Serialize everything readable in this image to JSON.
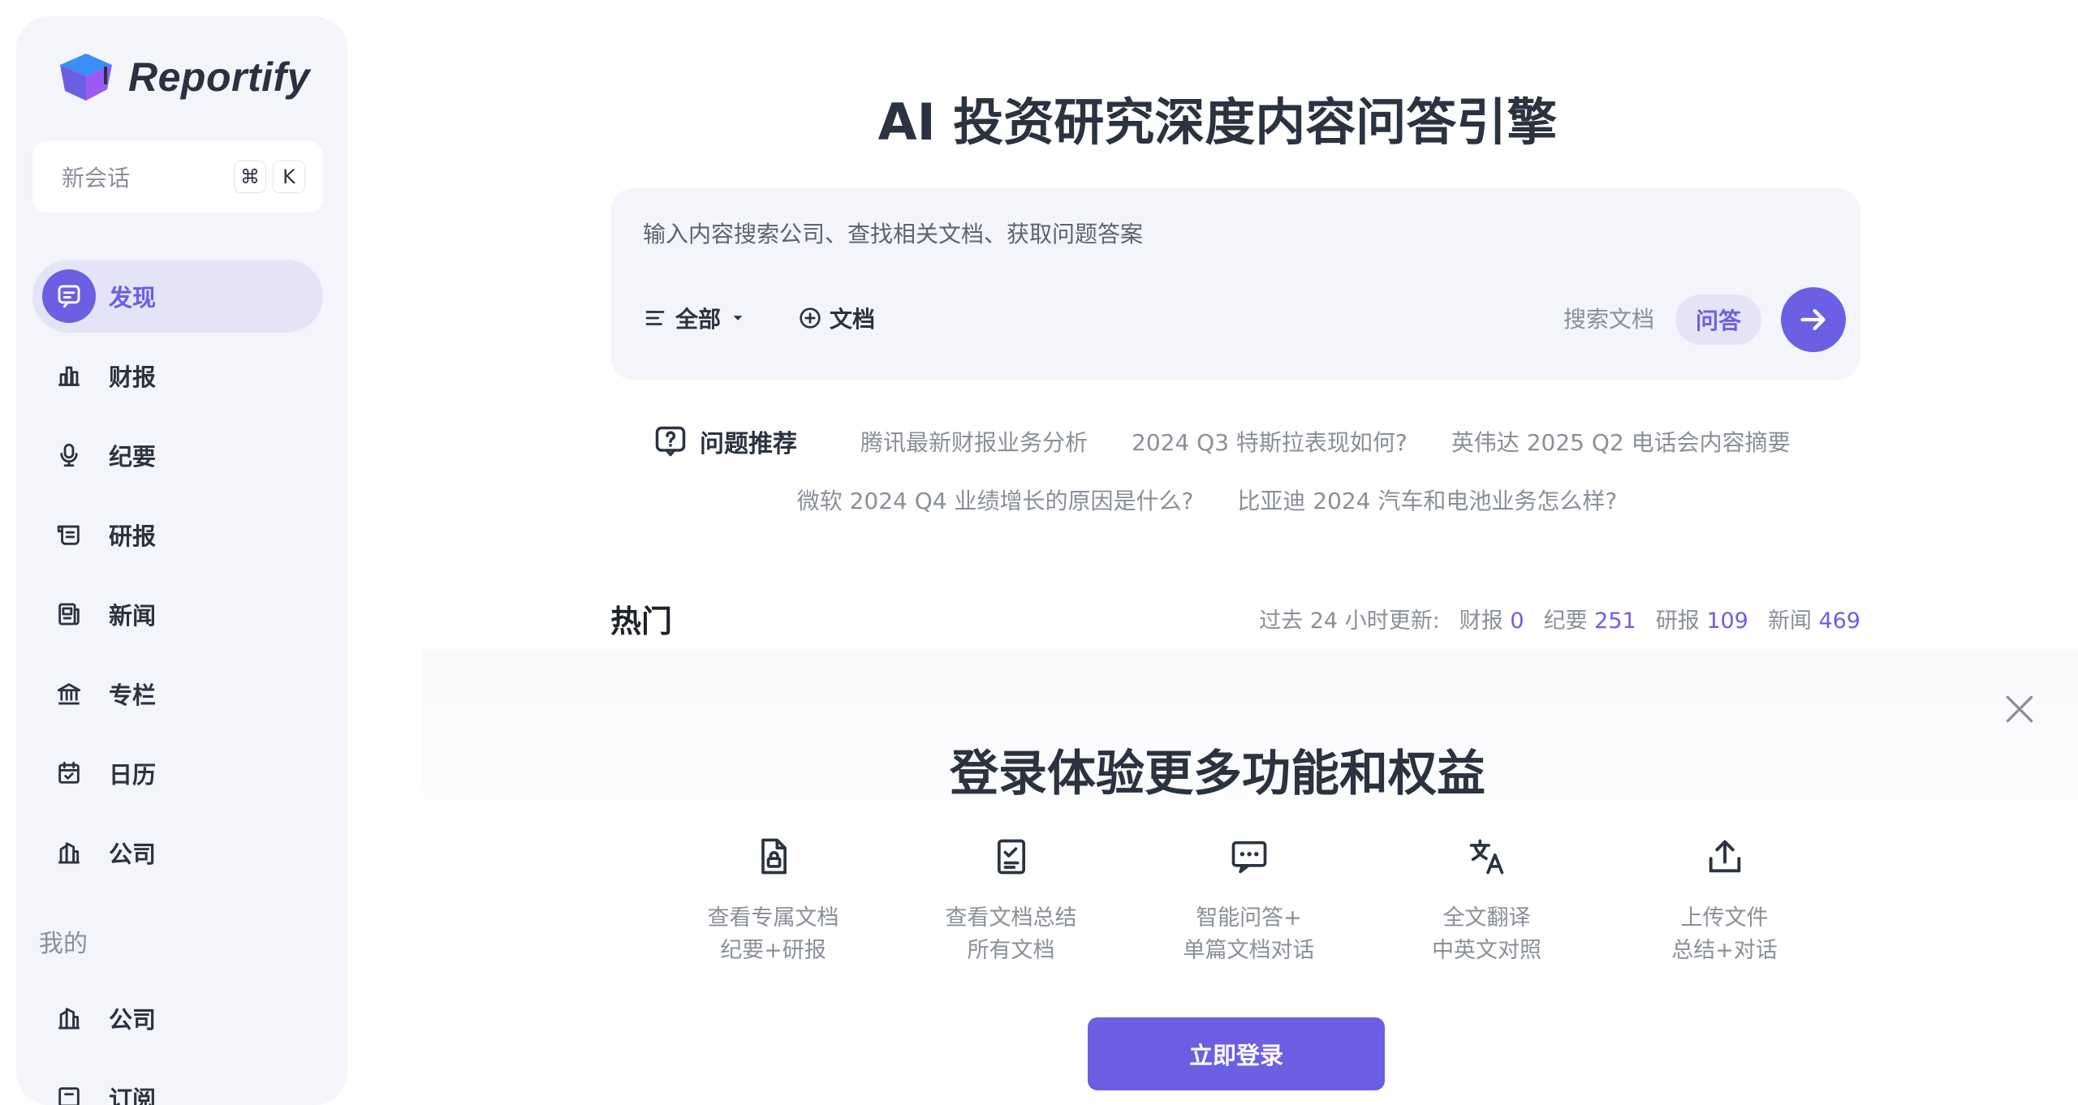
{
  "colors": {
    "accent": "#6b5fe3",
    "accent_soft": "#e5e4f7",
    "sidebar_bg": "#f4f5fa",
    "text": "#2b3340",
    "muted": "#8a8f99"
  },
  "sidebar": {
    "logo_text": "Reportify",
    "new_chat": {
      "label": "新会话",
      "shortcut_keys": [
        "⌘",
        "K"
      ]
    },
    "nav": [
      {
        "label": "发现",
        "icon": "chat-card-icon",
        "active": true
      },
      {
        "label": "财报",
        "icon": "bar-chart-icon"
      },
      {
        "label": "纪要",
        "icon": "microphone-icon"
      },
      {
        "label": "研报",
        "icon": "scroll-icon"
      },
      {
        "label": "新闻",
        "icon": "newspaper-icon"
      },
      {
        "label": "专栏",
        "icon": "bank-icon"
      },
      {
        "label": "日历",
        "icon": "calendar-icon"
      },
      {
        "label": "公司",
        "icon": "building-icon"
      }
    ],
    "mine_label": "我的",
    "mine": [
      {
        "label": "公司",
        "icon": "building-icon"
      },
      {
        "label": "订阅",
        "icon": "bookmark-icon"
      }
    ]
  },
  "main": {
    "title": "AI 投资研究深度内容问答引擎",
    "search": {
      "placeholder": "输入内容搜索公司、查找相关文档、获取问题答案",
      "filter_label": "全部",
      "doc_label": "文档",
      "mode_search": "搜索文档",
      "mode_qa": "问答"
    },
    "suggestions": {
      "title": "问题推荐",
      "items": [
        "腾讯最新财报业务分析",
        "2024 Q3 特斯拉表现如何?",
        "英伟达 2025 Q2 电话会内容摘要",
        "微软 2024 Q4 业绩增长的原因是什么?",
        "比亚迪 2024 汽车和电池业务怎么样?"
      ]
    },
    "hot": {
      "title": "热门",
      "updated_label": "过去 24 小时更新:",
      "stats": [
        {
          "label": "财报",
          "value": "0"
        },
        {
          "label": "纪要",
          "value": "251"
        },
        {
          "label": "研报",
          "value": "109"
        },
        {
          "label": "新闻",
          "value": "469"
        }
      ]
    }
  },
  "promo": {
    "title": "登录体验更多功能和权益",
    "features": [
      {
        "icon": "lock-document-icon",
        "line1": "查看专属文档",
        "line2": "纪要+研报"
      },
      {
        "icon": "checklist-icon",
        "line1": "查看文档总结",
        "line2": "所有文档"
      },
      {
        "icon": "chat-dots-icon",
        "line1": "智能问答+",
        "line2": "单篇文档对话"
      },
      {
        "icon": "translate-icon",
        "line1": "全文翻译",
        "line2": "中英文对照"
      },
      {
        "icon": "upload-icon",
        "line1": "上传文件",
        "line2": "总结+对话"
      }
    ],
    "login_button": "立即登录"
  }
}
